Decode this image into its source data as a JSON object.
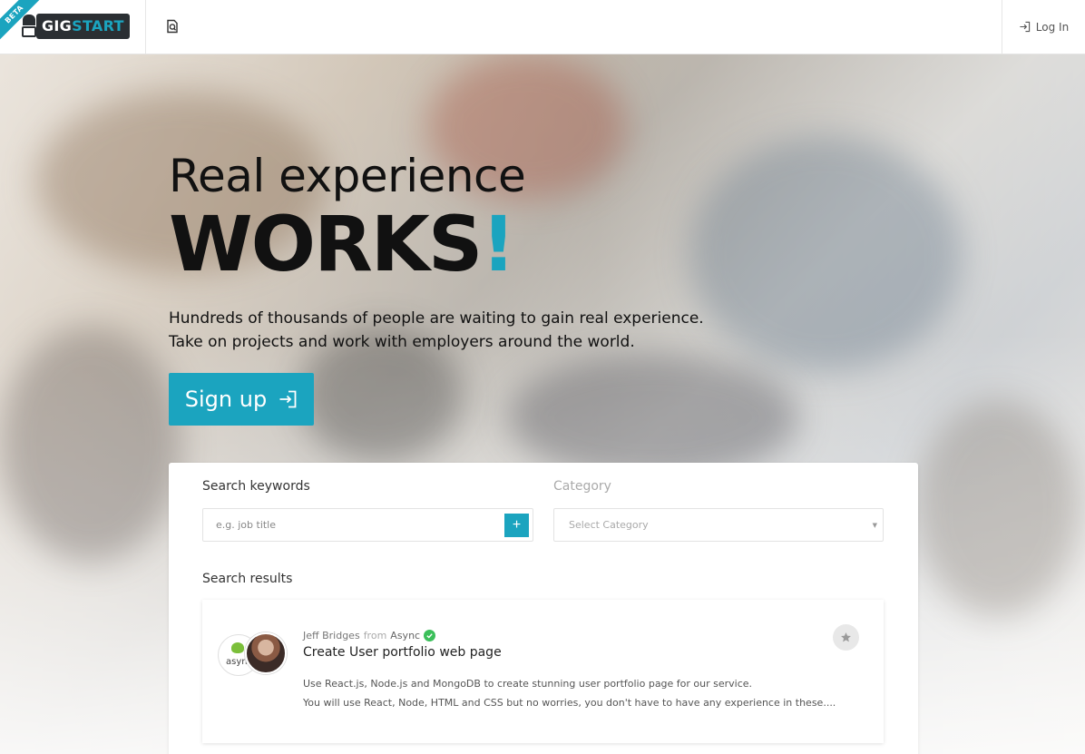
{
  "header": {
    "beta_label": "BETA",
    "logo": {
      "part1": "GIG",
      "part2": "START"
    },
    "login_label": "Log In"
  },
  "hero": {
    "headline_line1": "Real experience",
    "headline_line2": "WORKS",
    "headline_accent": "!",
    "subtext_line1": "Hundreds of thousands of people are waiting to gain real experience.",
    "subtext_line2": "Take on projects and work with employers around the world.",
    "signup_label": "Sign up"
  },
  "search": {
    "keywords_label": "Search keywords",
    "keywords_placeholder": "e.g. job title",
    "add_symbol": "+",
    "category_label": "Category",
    "category_placeholder": "Select Category",
    "results_label": "Search results"
  },
  "results": [
    {
      "author": "Jeff Bridges",
      "from_word": "from",
      "company": "Async",
      "company_logo_text": "async",
      "title": "Create User portfolio web page",
      "description_line1": "Use React.js, Node.js and MongoDB to create stunning user portfolio page for our service.",
      "description_line2": "You will use React, Node, HTML and CSS but no worries, you don't have to have any experience in these...."
    }
  ],
  "colors": {
    "accent": "#1ba4bf",
    "logo_dark": "#2b2f33",
    "verified": "#3bbf5a"
  },
  "icons": [
    "search-file-icon",
    "login-icon",
    "signup-arrow-icon",
    "plus-icon",
    "chevron-down-icon",
    "verified-check-icon",
    "star-icon"
  ]
}
